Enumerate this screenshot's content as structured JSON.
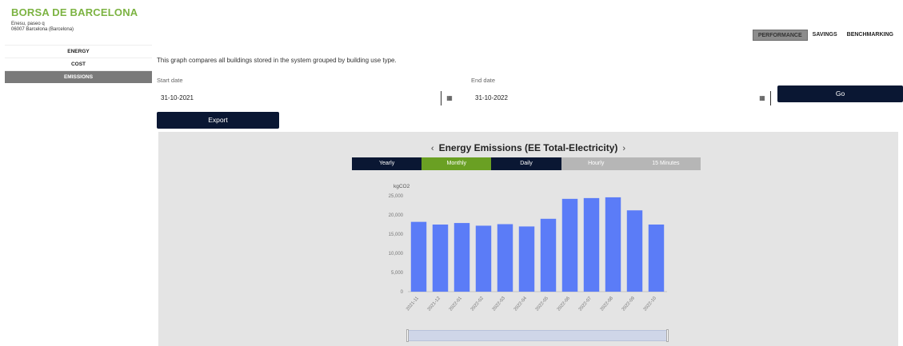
{
  "header": {
    "title": "BORSA DE BARCELONA",
    "address_line1": "Enesu, paseo q",
    "address_line2": "06007 Barcelona (Barcelona)"
  },
  "top_tabs": [
    {
      "label": "PERFORMANCE",
      "active": true
    },
    {
      "label": "SAVINGS",
      "active": false
    },
    {
      "label": "BENCHMARKING",
      "active": false
    }
  ],
  "sidebar": {
    "items": [
      {
        "label": "ENERGY",
        "active": false
      },
      {
        "label": "COST",
        "active": false
      },
      {
        "label": "EMISSIONS",
        "active": true
      }
    ]
  },
  "main": {
    "description": "This graph compares all buildings stored in the system grouped by building use type.",
    "start_date_label": "Start date",
    "start_date_value": "31-10-2021",
    "end_date_label": "End date",
    "end_date_value": "31-10-2022",
    "go_label": "Go",
    "export_label": "Export",
    "calendar_icon": "calendar-icon"
  },
  "chart_panel": {
    "prev_arrow": "‹",
    "next_arrow": "›",
    "title": "Energy Emissions (EE Total-Electricity)",
    "periods": [
      {
        "label": "Yearly",
        "state": "dark"
      },
      {
        "label": "Monthly",
        "state": "active"
      },
      {
        "label": "Daily",
        "state": "dark"
      },
      {
        "label": "Hourly",
        "state": "disabled"
      },
      {
        "label": "15 Minutes",
        "state": "disabled"
      }
    ]
  },
  "colors": {
    "brand": "#7cb342",
    "dark": "#0a1733",
    "bar": "#5b7cf7",
    "active_period": "#6aa023",
    "disabled_period": "#b6b6b6"
  },
  "chart_data": {
    "type": "bar",
    "ylabel": "kgCO2",
    "ylim": [
      0,
      25000
    ],
    "yticks": [
      "0",
      "5,000",
      "10,000",
      "15,000",
      "20,000",
      "25,000"
    ],
    "categories": [
      "2021-11",
      "2021-12",
      "2022-01",
      "2022-02",
      "2022-03",
      "2022-04",
      "2022-05",
      "2022-06",
      "2022-07",
      "2022-08",
      "2022-09",
      "2022-10"
    ],
    "values": [
      18200,
      17500,
      17900,
      17200,
      17600,
      17000,
      19000,
      24200,
      24400,
      24600,
      21200,
      17500
    ],
    "grid": false,
    "legend": "none"
  }
}
